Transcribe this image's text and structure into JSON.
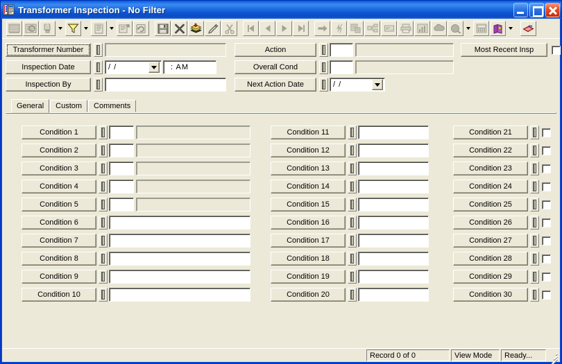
{
  "window": {
    "title": "Transformer Inspection - No Filter",
    "icon": "application-form-icon",
    "controls": {
      "minimize": "minimize-button",
      "maximize": "maximize-button",
      "close": "close-button"
    }
  },
  "toolbar": {
    "groups": [
      {
        "buttons": [
          {
            "icon": "design-view-icon",
            "enabled": false,
            "dropdown": false
          },
          {
            "icon": "query-view-icon",
            "enabled": false,
            "dropdown": false
          },
          {
            "icon": "sort-filter-icon",
            "enabled": false,
            "dropdown": true
          },
          {
            "icon": "filter-funnel-icon",
            "enabled": true,
            "dropdown": true
          },
          {
            "icon": "report-icon",
            "enabled": false,
            "dropdown": true
          },
          {
            "icon": "properties-icon",
            "enabled": false,
            "dropdown": false
          },
          {
            "icon": "refresh-icon",
            "enabled": false,
            "dropdown": false
          }
        ]
      },
      {
        "buttons": [
          {
            "icon": "save-icon",
            "enabled": true,
            "dropdown": false
          },
          {
            "icon": "delete-x-icon",
            "enabled": true,
            "dropdown": false
          },
          {
            "icon": "layers-icon",
            "enabled": true,
            "dropdown": false
          },
          {
            "icon": "edit-pencil-icon",
            "enabled": true,
            "dropdown": false
          },
          {
            "icon": "cut-scissors-icon",
            "enabled": false,
            "dropdown": false
          }
        ]
      },
      {
        "buttons": [
          {
            "icon": "first-record-icon",
            "enabled": false,
            "dropdown": false
          },
          {
            "icon": "previous-record-icon",
            "enabled": false,
            "dropdown": false
          },
          {
            "icon": "next-record-icon",
            "enabled": false,
            "dropdown": false
          },
          {
            "icon": "last-record-icon",
            "enabled": false,
            "dropdown": false
          }
        ]
      },
      {
        "buttons": [
          {
            "icon": "goto-record-icon",
            "enabled": false,
            "dropdown": false
          },
          {
            "icon": "lightning-icon",
            "enabled": false,
            "dropdown": false
          },
          {
            "icon": "attachments-icon",
            "enabled": false,
            "dropdown": false
          },
          {
            "icon": "related-records-icon",
            "enabled": false,
            "dropdown": false
          },
          {
            "icon": "notes-icon",
            "enabled": false,
            "dropdown": false
          },
          {
            "icon": "print-icon",
            "enabled": false,
            "dropdown": false
          },
          {
            "icon": "chart-icon",
            "enabled": false,
            "dropdown": false
          },
          {
            "icon": "cloud-icon",
            "enabled": false,
            "dropdown": false
          },
          {
            "icon": "search-globe-icon",
            "enabled": false,
            "dropdown": true
          },
          {
            "icon": "calculator-icon",
            "enabled": false,
            "dropdown": false
          },
          {
            "icon": "help-book-icon",
            "enabled": true,
            "dropdown": true
          },
          {
            "icon": "exit-door-icon",
            "enabled": true,
            "dropdown": false
          }
        ]
      }
    ]
  },
  "header_form": {
    "left": [
      {
        "label": "Transformer Number",
        "focused": true,
        "indicator": "record-indicator",
        "value": "",
        "field_kind": "wide-disabled"
      },
      {
        "label": "Inspection Date",
        "focused": false,
        "indicator": "record-indicator",
        "value": "/  /",
        "field_kind": "date-combo",
        "time_value": ":    AM"
      },
      {
        "label": "Inspection By",
        "focused": false,
        "indicator": "record-indicator",
        "value": "",
        "field_kind": "wide-white"
      }
    ],
    "right": [
      {
        "label": "Action",
        "indicator": "record-indicator",
        "code_value": "",
        "desc_value": "",
        "field_kind": "code-plus-desc"
      },
      {
        "label": "Overall Cond",
        "indicator": "record-indicator",
        "code_value": "",
        "desc_value": "",
        "field_kind": "code-plus-desc"
      },
      {
        "label": "Next Action Date",
        "indicator": "record-indicator",
        "value": "/  /",
        "field_kind": "date-combo"
      }
    ],
    "far_right": {
      "label": "Most Recent Insp",
      "checkbox_checked": false
    }
  },
  "tabs": [
    {
      "label": "General",
      "active": true
    },
    {
      "label": "Custom",
      "active": false
    },
    {
      "label": "Comments",
      "active": false
    }
  ],
  "conditions": {
    "column1": [
      {
        "label": "Condition 1",
        "kind": "code-desc",
        "code": "",
        "desc": ""
      },
      {
        "label": "Condition 2",
        "kind": "code-desc",
        "code": "",
        "desc": ""
      },
      {
        "label": "Condition 3",
        "kind": "code-desc",
        "code": "",
        "desc": ""
      },
      {
        "label": "Condition 4",
        "kind": "code-desc",
        "code": "",
        "desc": ""
      },
      {
        "label": "Condition 5",
        "kind": "code-desc",
        "code": "",
        "desc": ""
      },
      {
        "label": "Condition 6",
        "kind": "wide-text",
        "value": ""
      },
      {
        "label": "Condition 7",
        "kind": "wide-text",
        "value": ""
      },
      {
        "label": "Condition 8",
        "kind": "wide-text",
        "value": ""
      },
      {
        "label": "Condition 9",
        "kind": "wide-text",
        "value": ""
      },
      {
        "label": "Condition 10",
        "kind": "wide-text",
        "value": ""
      }
    ],
    "column2": [
      {
        "label": "Condition 11",
        "kind": "text",
        "value": ""
      },
      {
        "label": "Condition 12",
        "kind": "text",
        "value": ""
      },
      {
        "label": "Condition 13",
        "kind": "text",
        "value": ""
      },
      {
        "label": "Condition 14",
        "kind": "text",
        "value": ""
      },
      {
        "label": "Condition 15",
        "kind": "text",
        "value": ""
      },
      {
        "label": "Condition 16",
        "kind": "text",
        "value": ""
      },
      {
        "label": "Condition 17",
        "kind": "text",
        "value": ""
      },
      {
        "label": "Condition 18",
        "kind": "text",
        "value": ""
      },
      {
        "label": "Condition 19",
        "kind": "text",
        "value": ""
      },
      {
        "label": "Condition 20",
        "kind": "text",
        "value": ""
      }
    ],
    "column3": [
      {
        "label": "Condition 21",
        "kind": "checkbox",
        "checked": false
      },
      {
        "label": "Condition 22",
        "kind": "checkbox",
        "checked": false
      },
      {
        "label": "Condition 23",
        "kind": "checkbox",
        "checked": false
      },
      {
        "label": "Condition 24",
        "kind": "checkbox",
        "checked": false
      },
      {
        "label": "Condition 25",
        "kind": "checkbox",
        "checked": false
      },
      {
        "label": "Condition 26",
        "kind": "checkbox",
        "checked": false
      },
      {
        "label": "Condition 27",
        "kind": "checkbox",
        "checked": false
      },
      {
        "label": "Condition 28",
        "kind": "checkbox",
        "checked": false
      },
      {
        "label": "Condition 29",
        "kind": "checkbox",
        "checked": false
      },
      {
        "label": "Condition 30",
        "kind": "checkbox",
        "checked": false
      }
    ]
  },
  "statusbar": {
    "record_count": "Record 0 of 0",
    "mode": "View Mode",
    "state": "Ready..."
  },
  "colors": {
    "title_blue": "#0a59d6",
    "face": "#ece9d8",
    "window_border": "#0a46d2",
    "field_white": "#ffffff",
    "shadow": "#808080",
    "funnel_yellow": "#f5e03c",
    "close_red": "#e5512b"
  }
}
